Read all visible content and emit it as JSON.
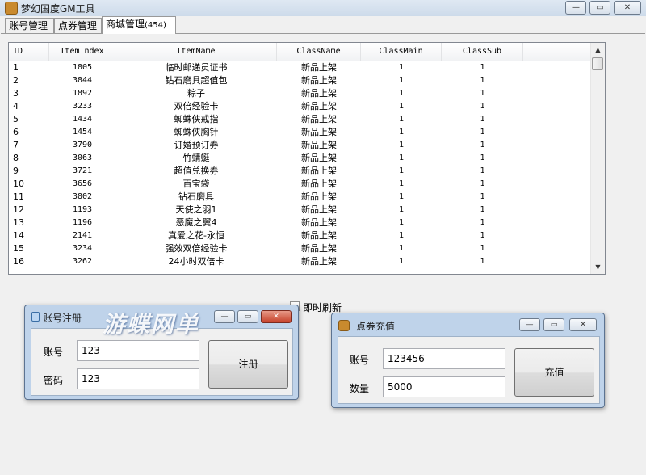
{
  "window": {
    "title": "梦幻国度GM工具",
    "minimize_label": "—",
    "maximize_label": "▭",
    "close_label": "✕"
  },
  "tabs": [
    {
      "label": "账号管理"
    },
    {
      "label": "点券管理"
    },
    {
      "label": "商城管理",
      "count": "(454)"
    }
  ],
  "table": {
    "columns": [
      "ID",
      "ItemIndex",
      "ItemName",
      "ClassName",
      "ClassMain",
      "ClassSub"
    ],
    "rows": [
      [
        "1",
        "1805",
        "临时邮递员证书",
        "新品上架",
        "1",
        "1"
      ],
      [
        "2",
        "3844",
        "钻石磨具超值包",
        "新品上架",
        "1",
        "1"
      ],
      [
        "3",
        "1892",
        "粽子",
        "新品上架",
        "1",
        "1"
      ],
      [
        "4",
        "3233",
        "双倍经验卡",
        "新品上架",
        "1",
        "1"
      ],
      [
        "5",
        "1434",
        "蜘蛛侠戒指",
        "新品上架",
        "1",
        "1"
      ],
      [
        "6",
        "1454",
        "蜘蛛侠胸针",
        "新品上架",
        "1",
        "1"
      ],
      [
        "7",
        "3790",
        "订婚预订券",
        "新品上架",
        "1",
        "1"
      ],
      [
        "8",
        "3063",
        "竹蜻蜓",
        "新品上架",
        "1",
        "1"
      ],
      [
        "9",
        "3721",
        "超值兑换券",
        "新品上架",
        "1",
        "1"
      ],
      [
        "10",
        "3656",
        "百宝袋",
        "新品上架",
        "1",
        "1"
      ],
      [
        "11",
        "3802",
        "钻石磨具",
        "新品上架",
        "1",
        "1"
      ],
      [
        "12",
        "1193",
        "天使之羽1",
        "新品上架",
        "1",
        "1"
      ],
      [
        "13",
        "1196",
        "恶魔之翼4",
        "新品上架",
        "1",
        "1"
      ],
      [
        "14",
        "2141",
        "真爱之花-永恒",
        "新品上架",
        "1",
        "1"
      ],
      [
        "15",
        "3234",
        "强效双倍经验卡",
        "新品上架",
        "1",
        "1"
      ],
      [
        "16",
        "3262",
        "24小时双倍卡",
        "新品上架",
        "1",
        "1"
      ]
    ]
  },
  "refresh_checkbox": {
    "label": "即时刷新",
    "checked": false
  },
  "register_dialog": {
    "title": "账号注册",
    "account_label": "账号",
    "account_value": "123",
    "password_label": "密码",
    "password_value": "123",
    "submit_label": "注册"
  },
  "recharge_dialog": {
    "title": "点券充值",
    "account_label": "账号",
    "account_value": "123456",
    "amount_label": "数量",
    "amount_value": "5000",
    "submit_label": "充值"
  },
  "watermark": "游蝶网单",
  "colors": {
    "title_bg": "#cddbea",
    "dialog_frame": "#bfd3ea",
    "close_red": "#c6412a"
  }
}
